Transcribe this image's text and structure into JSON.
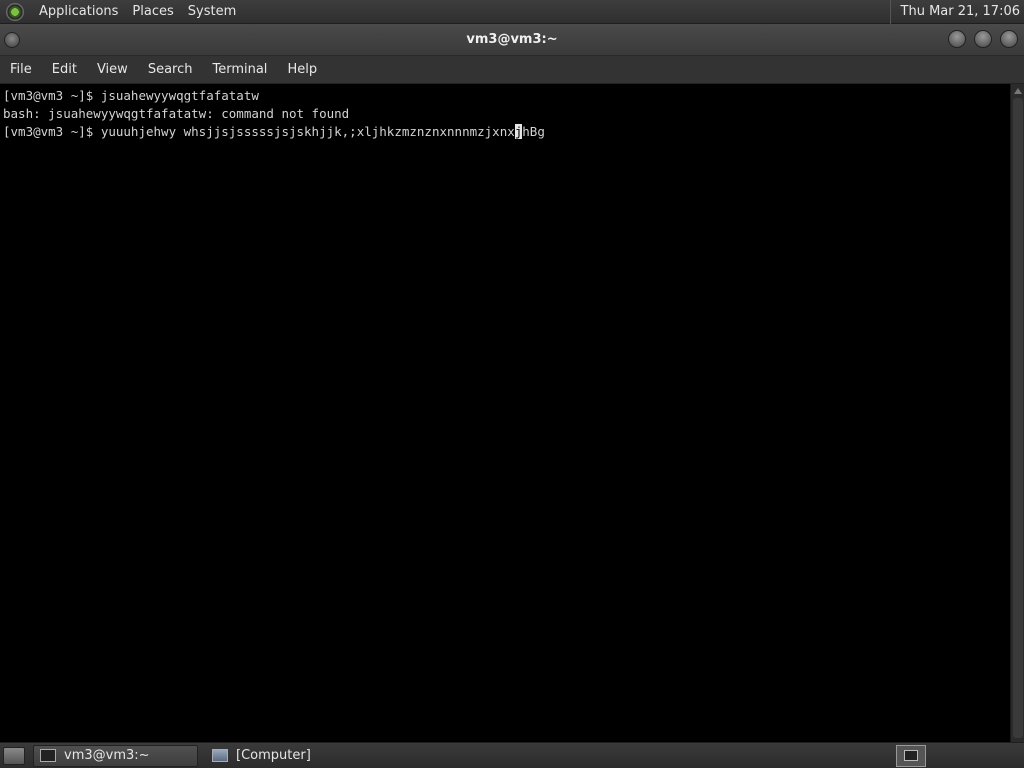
{
  "top_panel": {
    "menus": [
      "Applications",
      "Places",
      "System"
    ],
    "clock": "Thu Mar 21, 17:06"
  },
  "window": {
    "title": "vm3@vm3:~"
  },
  "menubar": {
    "items": [
      "File",
      "Edit",
      "View",
      "Search",
      "Terminal",
      "Help"
    ]
  },
  "terminal": {
    "line1": "[vm3@vm3 ~]$ jsuahewyywqgtfafatatw",
    "line2": "bash: jsuahewyywqgtfafatatw: command not found",
    "line3_before_cursor": "[vm3@vm3 ~]$ yuuuhjehwy whsjjsjsssssjsjskhjjk,;xljhkzmznznxnnnmzjxnx",
    "cursor_char": "j",
    "line3_after_cursor": "hBg"
  },
  "taskbar": {
    "tasks": [
      {
        "label": "vm3@vm3:~",
        "icon": "terminal-icon",
        "active": true
      },
      {
        "label": "[Computer]",
        "icon": "computer-icon",
        "active": false
      }
    ]
  }
}
